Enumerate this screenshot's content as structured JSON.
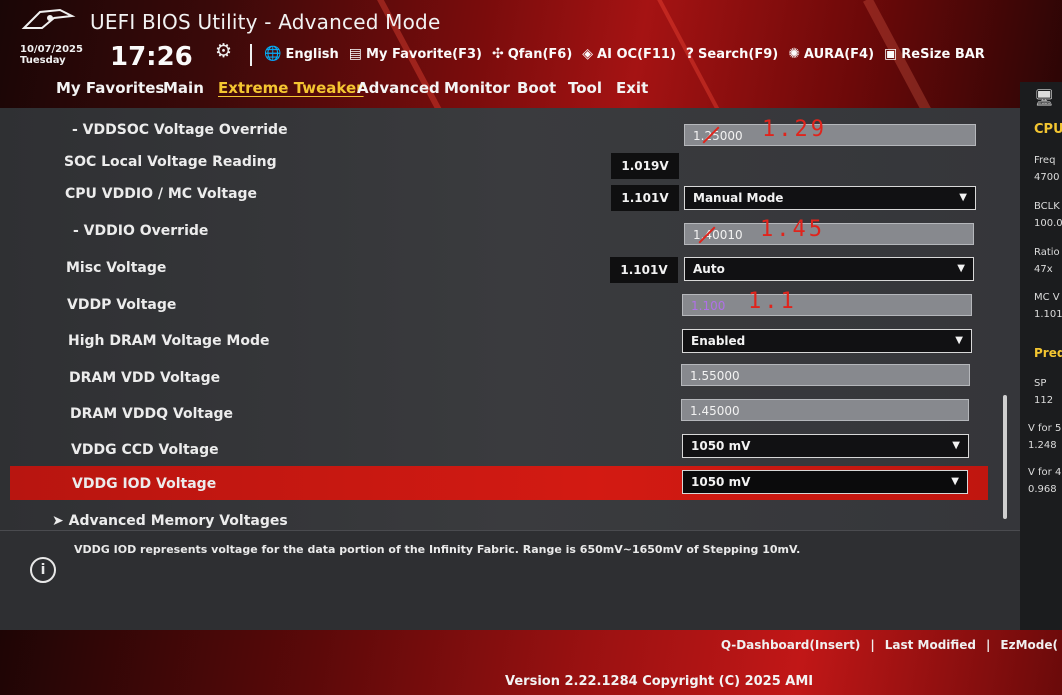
{
  "header": {
    "title": "UEFI BIOS Utility - Advanced Mode",
    "date": "10/07/2025",
    "day": "Tuesday",
    "time": "17:26",
    "toolbar": [
      {
        "label": "English",
        "icon": "globe-icon",
        "glyph": "🌐"
      },
      {
        "label": "My Favorite(F3)",
        "icon": "favorite-icon",
        "glyph": "▤"
      },
      {
        "label": "Qfan(F6)",
        "icon": "fan-icon",
        "glyph": "✣"
      },
      {
        "label": "AI OC(F11)",
        "icon": "ai-chip-icon",
        "glyph": "◈"
      },
      {
        "label": "Search(F9)",
        "icon": "search-icon",
        "glyph": "?"
      },
      {
        "label": "AURA(F4)",
        "icon": "aura-icon",
        "glyph": "✺"
      },
      {
        "label": "ReSize BAR",
        "icon": "resize-bar-icon",
        "glyph": "▣"
      }
    ]
  },
  "tabs": [
    "My Favorites",
    "Main",
    "Extreme Tweaker",
    "Advanced",
    "Monitor",
    "Boot",
    "Tool",
    "Exit"
  ],
  "active_tab": "Extreme Tweaker",
  "settings": {
    "vddsoc_override": {
      "label": "- VDDSOC Voltage Override",
      "value": "1.25000",
      "note": "1.29"
    },
    "soc_reading": {
      "label": "SOC Local Voltage Reading",
      "reading": "1.019V"
    },
    "cpu_vddio": {
      "label": "CPU VDDIO / MC Voltage",
      "reading": "1.101V",
      "value": "Manual Mode"
    },
    "vddio_override": {
      "label": "- VDDIO Override",
      "value": "1.40010",
      "note": "1.45"
    },
    "misc_voltage": {
      "label": "Misc Voltage",
      "reading": "1.101V",
      "value": "Auto"
    },
    "vddp_voltage": {
      "label": "VDDP Voltage",
      "value": "1.100",
      "note": "1.1"
    },
    "high_dram_mode": {
      "label": "High DRAM Voltage Mode",
      "value": "Enabled"
    },
    "dram_vdd": {
      "label": "DRAM VDD Voltage",
      "value": "1.55000"
    },
    "dram_vddq": {
      "label": "DRAM VDDQ Voltage",
      "value": "1.45000"
    },
    "vddg_ccd": {
      "label": "VDDG CCD Voltage",
      "value": "1050 mV"
    },
    "vddg_iod": {
      "label": "VDDG IOD Voltage",
      "value": "1050 mV"
    }
  },
  "submenu": "Advanced Memory Voltages",
  "info_text": "VDDG IOD represents voltage for the data portion of the Infinity Fabric. Range is 650mV~1650mV of Stepping 10mV.",
  "sidebar": {
    "cpu": "CPU",
    "freq_label": "Freq",
    "freq_value": "4700",
    "bclk_label": "BCLK",
    "bclk_value": "100.0",
    "ratio_label": "Ratio",
    "ratio_value": "47x",
    "mcv_label": "MC V",
    "mcv_value": "1.101",
    "pred": "Pred",
    "sp_label": "SP",
    "sp_value": "112",
    "vfor1_label": "V for 5",
    "vfor1_value": "1.248",
    "vfor2_label": "V for 4",
    "vfor2_value": "0.968"
  },
  "footer": {
    "qdash": "Q-Dashboard(Insert)",
    "last_modified": "Last Modified",
    "ezmode": "EzMode(",
    "version": "Version 2.22.1284 Copyright (C) 2025 AMI"
  },
  "colors": {
    "accent_red": "#d31a12",
    "tab_active": "#f4c631",
    "annotation": "#e0241c"
  }
}
